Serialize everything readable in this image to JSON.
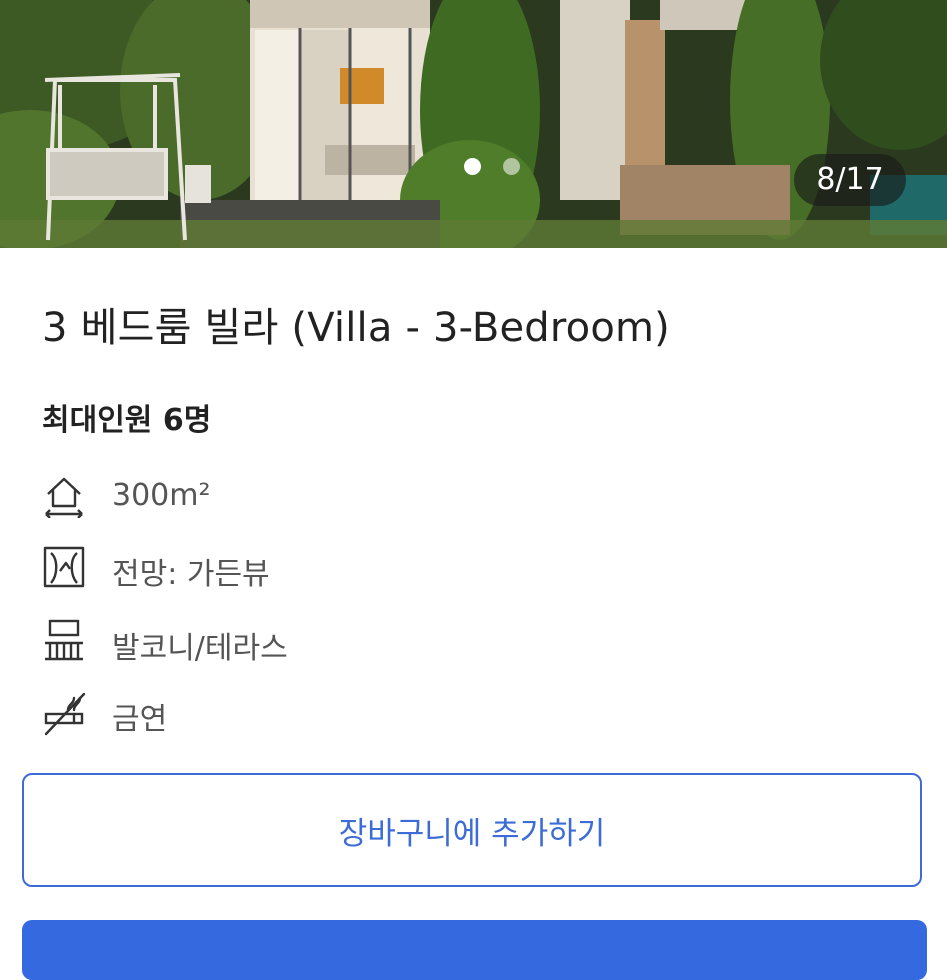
{
  "gallery": {
    "counter": "8/17",
    "dots": [
      {
        "active": true
      },
      {
        "active": false
      }
    ]
  },
  "room": {
    "title": "3 베드룸 빌라 (Villa - 3-Bedroom)",
    "occupancy": "최대인원 6명"
  },
  "features": [
    {
      "icon": "house-area-icon",
      "label": "300m²"
    },
    {
      "icon": "window-view-icon",
      "label": "전망: 가든뷰"
    },
    {
      "icon": "balcony-icon",
      "label": "발코니/테라스"
    },
    {
      "icon": "no-smoking-icon",
      "label": "금연"
    }
  ],
  "actions": {
    "add_to_cart": "장바구니에 추가하기"
  },
  "colors": {
    "accent": "#3d6cd6",
    "primary_button": "#3469e0",
    "text_dark": "#222222",
    "text_muted": "#555555"
  }
}
